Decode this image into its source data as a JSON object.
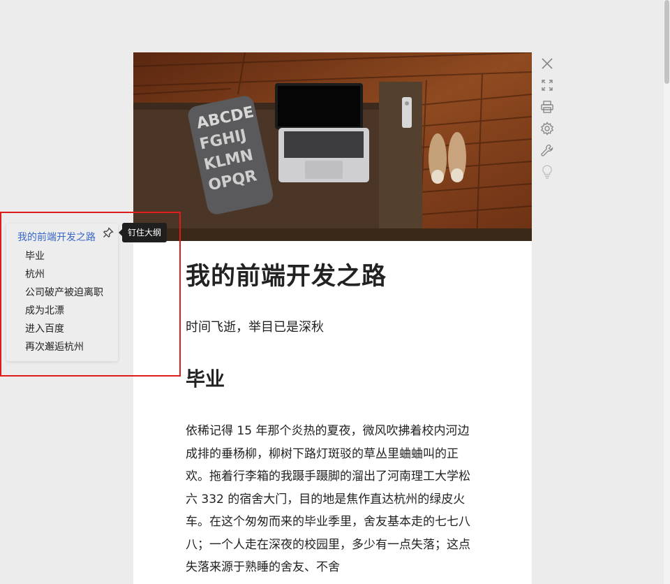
{
  "article": {
    "title": "我的前端开发之路",
    "subtitle": "时间飞逝，举目已是深秋",
    "sections": [
      {
        "heading": "毕业",
        "paragraph": "依稀记得 15 年那个炎热的夏夜，微风吹拂着校内河边成排的垂杨柳，柳树下路灯斑驳的草丛里蛐蛐叫的正欢。拖着行李箱的我蹑手蹑脚的溜出了河南理工大学松六 332 的宿舍大门，目的地是焦作直达杭州的绿皮火车。在这个匆匆而来的毕业季里，舍友基本走的七七八八；一个人走在深夜的校园里，多少有一点失落；这点失落来源于熟睡的舍友、不舍"
      }
    ]
  },
  "outline": {
    "title": "我的前端开发之路",
    "items": [
      "毕业",
      "杭州",
      "公司破产被迫离职",
      "成为北漂",
      "进入百度",
      "再次邂逅杭州"
    ],
    "pin_tooltip": "钉住大纲"
  },
  "toolbar": {
    "icons": [
      "close-icon",
      "fullscreen-icon",
      "print-icon",
      "settings-icon",
      "wrench-icon",
      "lightbulb-icon"
    ]
  },
  "colors": {
    "outline_link": "#3a67c8",
    "highlight_border": "#e01b1b",
    "tooltip_bg": "#1f1f1f"
  }
}
